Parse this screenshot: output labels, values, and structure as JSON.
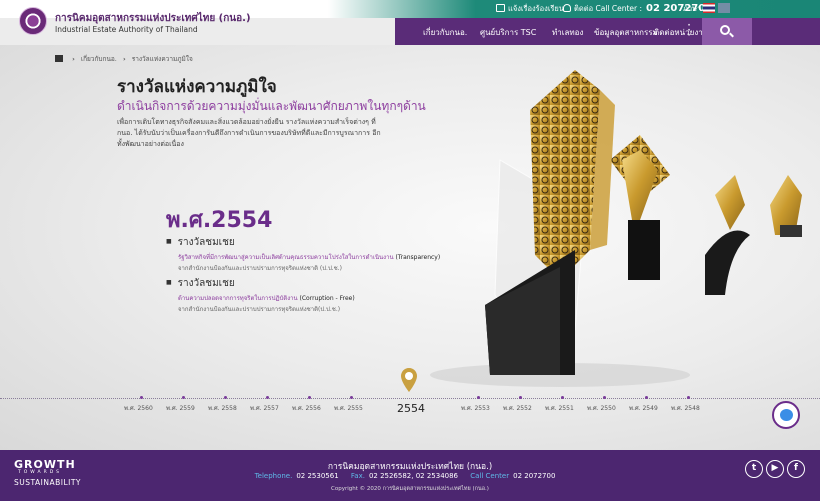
{
  "topbar": {
    "complaint": "แจ้งเรื่องร้องเรียน",
    "callcenter_label": "ติดต่อ Call Center :",
    "callcenter_number": "02 2072700",
    "language_label": "ภาษา"
  },
  "header": {
    "org_name_th": "การนิคมอุตสาหกรรมแห่งประเทศไทย (กนอ.)",
    "org_name_en": "Industrial Estate Authority of Thailand"
  },
  "nav": {
    "items": [
      "เกี่ยวกับกนอ.",
      "ศูนย์บริการ TSC",
      "ทำเลทอง",
      "ข้อมูลอุตสาหกรรม",
      "ติดต่อหน่วยงาน"
    ]
  },
  "breadcrumb": [
    "เกี่ยวกับกนอ.",
    "รางวัลแห่งความภูมิใจ"
  ],
  "page": {
    "title": "รางวัลแห่งความภูมิใจ",
    "subtitle": "ดำเนินกิจการด้วยความมุ่งมั่นและพัฒนาศักยภาพในทุกๆด้าน",
    "description": "เพื่อการเติบโตทางธุรกิจสังคมและสิ่งแวดล้อมอย่างยั่งยืน รางวัลแห่งความสำเร็จต่างๆ ที่ กนอ. ได้รับนับว่าเป็นเครื่องการันตีถึงการดำเนินการของบริษัทที่ดีและมีการบูรณาการ อีกทั้งพัฒนาอย่างต่อเนื่อง"
  },
  "year_heading": "พ.ศ.2554",
  "awards": [
    {
      "title": "รางวัลชมเชย",
      "line": "รัฐวิสาหกิจที่มีการพัฒนาสู่ความเป็นเลิศด้านคุณธรรมความโปร่งใสในการดำเนินงาน",
      "line_en": "(Transparency)",
      "source": "จากสำนักงานป้องกันและปราบปรามการทุจริตแห่งชาติ (ป.ป.ช.)"
    },
    {
      "title": "รางวัลชมเชย",
      "line": "ด้านความปลอดจากการทุจริตในการปฏิบัติงาน",
      "line_en": "(Corruption - Free)",
      "source": "จากสำนักงานป้องกันและปราบปรามการทุจริตแห่งชาติ(ป.ป.ช.)"
    }
  ],
  "timeline": {
    "left_years": [
      "พ.ศ. 2560",
      "พ.ศ. 2559",
      "พ.ศ. 2558",
      "พ.ศ. 2557",
      "พ.ศ. 2556",
      "พ.ศ. 2555"
    ],
    "active_year": "2554",
    "right_years": [
      "พ.ศ. 2553",
      "พ.ศ. 2552",
      "พ.ศ. 2551",
      "พ.ศ. 2550",
      "พ.ศ. 2549",
      "พ.ศ. 2548"
    ]
  },
  "footer": {
    "growth": "GROWTH",
    "towards": "TOWARDS",
    "sustainability": "SUSTAINABILITY",
    "org_name": "การนิคมอุตสาหกรรมแห่งประเทศไทย (กนอ.)",
    "telephone_label": "Telephone.",
    "telephone": "02 2530561",
    "fax_label": "Fax.",
    "fax": "02 2526582, 02 2534086",
    "callcenter_label": "Call Center",
    "callcenter": "02 2072700",
    "copyright": "Copyright © 2020 การนิคมอุตสาหกรรมแห่งประเทศไทย (กนอ.)"
  },
  "colors": {
    "brand_purple": "#5a2c78",
    "accent_teal": "#1e8a79",
    "footer_purple": "#4c2670",
    "highlight_purple": "#8d3e9f"
  }
}
